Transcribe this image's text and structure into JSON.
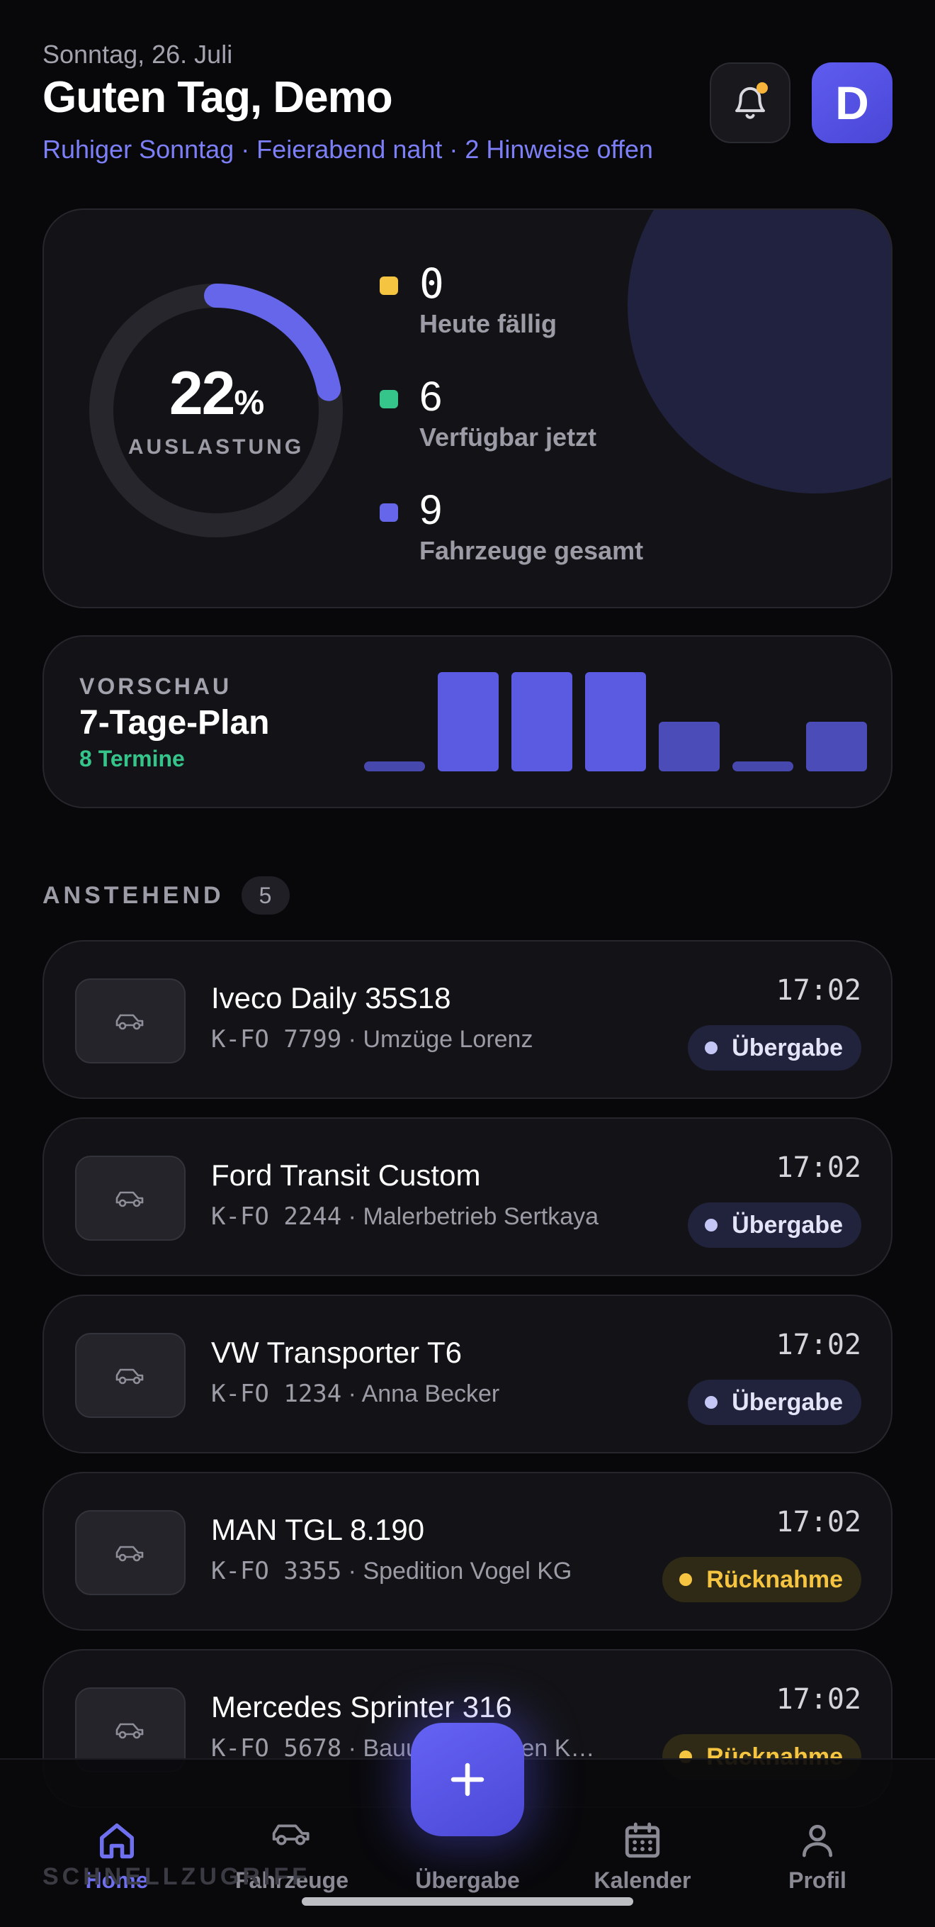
{
  "header": {
    "date": "Sonntag, 26. Juli",
    "greeting": "Guten Tag, Demo",
    "subline": "Ruhiger Sonntag · Feierabend naht · 2 Hinweise offen",
    "avatar_initial": "D",
    "bell_icon": "bell-icon",
    "notification_dot_color": "#f6b43b"
  },
  "summary": {
    "utilization_value": "22",
    "utilization_unit": "%",
    "utilization_fraction": 0.22,
    "utilization_label": "AUSLASTUNG",
    "stats": [
      {
        "value": "0",
        "label": "Heute fällig",
        "color": "#f5c542"
      },
      {
        "value": "6",
        "label": "Verfügbar jetzt",
        "color": "#35c48a"
      },
      {
        "value": "9",
        "label": "Fahrzeuge gesamt",
        "color": "#6566ea"
      }
    ]
  },
  "plan": {
    "overline": "VORSCHAU",
    "title": "7-Tage-Plan",
    "subtitle": "8 Termine",
    "day_counts": [
      0,
      2,
      2,
      2,
      1,
      0,
      1
    ],
    "bar_color": "#5a5be0"
  },
  "upcoming": {
    "title": "ANSTEHEND",
    "count": "5",
    "items": [
      {
        "title": "Iveco Daily 35S18",
        "plate": "K-FO 7799",
        "customer": "Umzüge Lorenz",
        "time": "17:02",
        "status": "Übergabe",
        "type": "handover"
      },
      {
        "title": "Ford Transit Custom",
        "plate": "K-FO 2244",
        "customer": "Malerbetrieb Sertkaya",
        "time": "17:02",
        "status": "Übergabe",
        "type": "handover"
      },
      {
        "title": "VW Transporter T6",
        "plate": "K-FO 1234",
        "customer": "Anna Becker",
        "time": "17:02",
        "status": "Übergabe",
        "type": "handover"
      },
      {
        "title": "MAN TGL 8.190",
        "plate": "K-FO 3355",
        "customer": "Spedition Vogel KG",
        "time": "17:02",
        "status": "Rücknahme",
        "type": "return"
      },
      {
        "title": "Mercedes Sprinter 316",
        "plate": "K-FO 5678",
        "customer": "Bauunternehmen K…",
        "time": "17:02",
        "status": "Rücknahme",
        "type": "return"
      }
    ]
  },
  "next_section_peek": "SCHNELLZUGRIFF",
  "nav": {
    "items": [
      {
        "label": "Home",
        "icon": "home-icon",
        "active": true
      },
      {
        "label": "Fahrzeuge",
        "icon": "car-icon",
        "active": false
      },
      {
        "label": "Übergabe",
        "icon": "plus-icon",
        "active": false
      },
      {
        "label": "Kalender",
        "icon": "calendar-icon",
        "active": false
      },
      {
        "label": "Profil",
        "icon": "user-icon",
        "active": false
      }
    ],
    "fab_icon": "plus-icon",
    "accent": "#6f70f0"
  }
}
